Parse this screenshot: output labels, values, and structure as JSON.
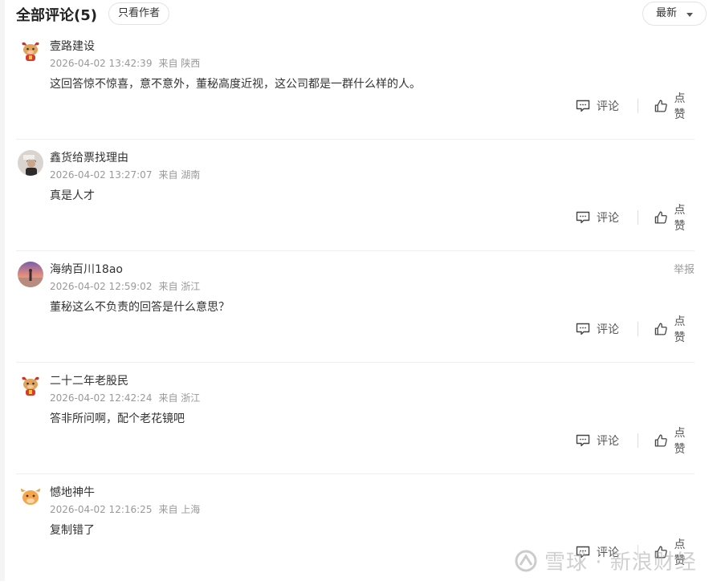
{
  "header": {
    "title": "全部评论(5)",
    "author_only_label": "只看作者",
    "sort_label": "最新"
  },
  "actions": {
    "comment_label": "评论",
    "like_label": "点赞",
    "report_label": "举报"
  },
  "comments": [
    {
      "username": "壹路建设",
      "time": "2026-04-02 13:42:39",
      "location": "来自 陕西",
      "text": "这回答惊不惊喜，意不意外，董秘高度近视，这公司都是一群什么样的人。",
      "avatar": "ox-icon"
    },
    {
      "username": "鑫货给票找理由",
      "time": "2026-04-02 13:27:07",
      "location": "来自 湖南",
      "text": "真是人才",
      "avatar": "photo-avatar"
    },
    {
      "username": "海纳百川18ao",
      "time": "2026-04-02 12:59:02",
      "location": "来自 浙江",
      "text": "董秘这么不负责的回答是什么意思？",
      "avatar": "sunset-avatar"
    },
    {
      "username": "二十二年老股民",
      "time": "2026-04-02 12:42:24",
      "location": "来自 浙江",
      "text": "答非所问啊，配个老花镜吧",
      "avatar": "ox-icon"
    },
    {
      "username": "憾地神牛",
      "time": "2026-04-02 12:16:25",
      "location": "来自 上海",
      "text": "复制错了",
      "avatar": "bull-icon"
    }
  ],
  "watermark": "雪球 · 新浪财经"
}
